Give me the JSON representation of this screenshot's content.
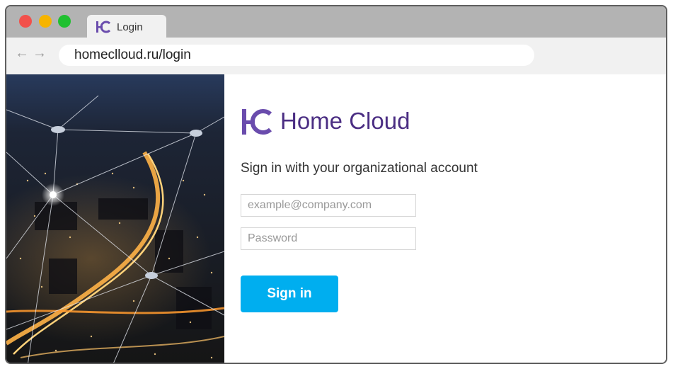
{
  "browser": {
    "tab": {
      "title": "Login",
      "logo_icon": "home-cloud-logo-icon"
    },
    "nav": {
      "back_icon": "←",
      "forward_icon": "→"
    },
    "address": "homeclloud.ru/login"
  },
  "login": {
    "brand_name": "Home Cloud",
    "brand_logo_icon": "home-cloud-logo-icon",
    "heading": "Sign in with your organizational account",
    "email_placeholder": "example@company.com",
    "password_placeholder": "Password",
    "signin_label": "Sign in"
  },
  "colors": {
    "brand_purple": "#6a4cad",
    "brand_text": "#4b2e83",
    "signin_button": "#00aeef",
    "titlebar": "#b3b3b3"
  }
}
